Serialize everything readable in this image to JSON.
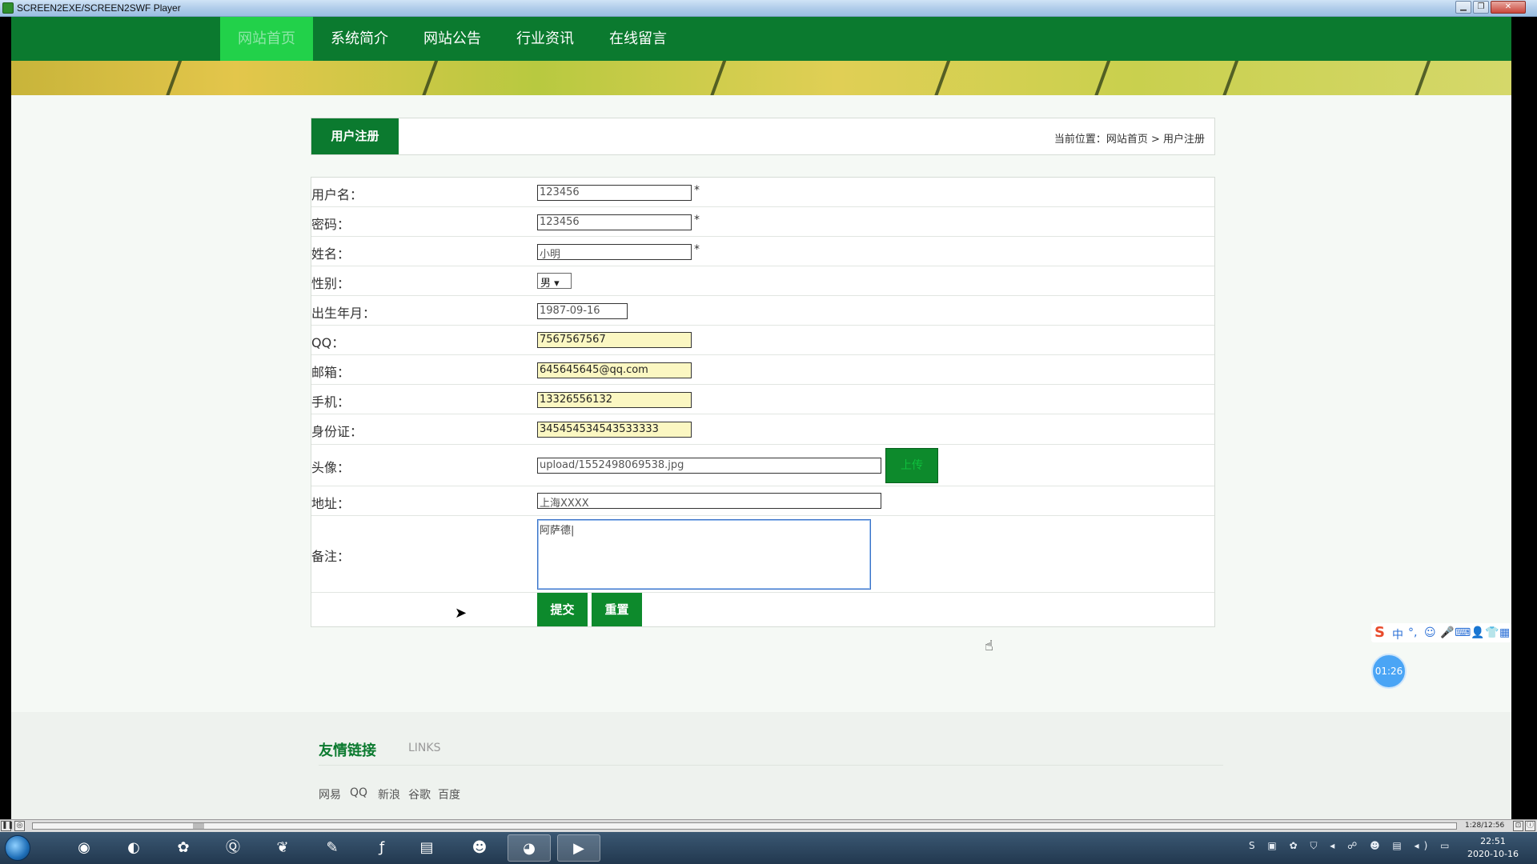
{
  "window": {
    "title": "SCREEN2EXE/SCREEN2SWF Player",
    "min": "▁",
    "max": "❐",
    "close": "✕"
  },
  "nav": {
    "items": [
      "网站首页",
      "系统简介",
      "网站公告",
      "行业资讯",
      "在线留言"
    ],
    "active_index": 0
  },
  "register": {
    "tab_label": "用户注册",
    "breadcrumb": "当前位置：网站首页 > 用户注册",
    "fields": {
      "username": {
        "label": "用户名：",
        "value": "123456",
        "required": "*"
      },
      "password": {
        "label": "密码：",
        "value": "123456",
        "required": "*"
      },
      "name": {
        "label": "姓名：",
        "value": "小明",
        "required": "*"
      },
      "gender": {
        "label": "性别：",
        "value": "男 ▾"
      },
      "birth": {
        "label": "出生年月：",
        "value": "1987-09-16"
      },
      "qq": {
        "label": "QQ：",
        "value": "7567567567"
      },
      "email": {
        "label": "邮箱：",
        "value": "645645645@qq.com"
      },
      "phone": {
        "label": "手机：",
        "value": "13326556132"
      },
      "idcard": {
        "label": "身份证：",
        "value": "345454534543533333"
      },
      "avatar": {
        "label": "头像：",
        "value": "upload/1552498069538.jpg",
        "button": "上传"
      },
      "address": {
        "label": "地址：",
        "value": "上海XXXX"
      },
      "remark": {
        "label": "备注：",
        "value": "阿萨德|"
      }
    },
    "submit": "提交",
    "reset": "重置"
  },
  "footer": {
    "title": "友情链接",
    "subtitle": "LINKS",
    "links": [
      "网易",
      "QQ",
      "新浪",
      "谷歌",
      "百度"
    ]
  },
  "overlay": {
    "timer": "01:26",
    "ime": [
      "中",
      "°,",
      "☺",
      "🎤",
      "⌨",
      "👤",
      "👕",
      "▦"
    ]
  },
  "player": {
    "time": "1:28/12:56"
  },
  "taskbar": {
    "time": "22:51",
    "date": "2020-10-16"
  },
  "colors": {
    "primary_green": "#0b7a2f",
    "nav_active": "#22d14a",
    "highlight_yellow": "#fbf7c2"
  }
}
